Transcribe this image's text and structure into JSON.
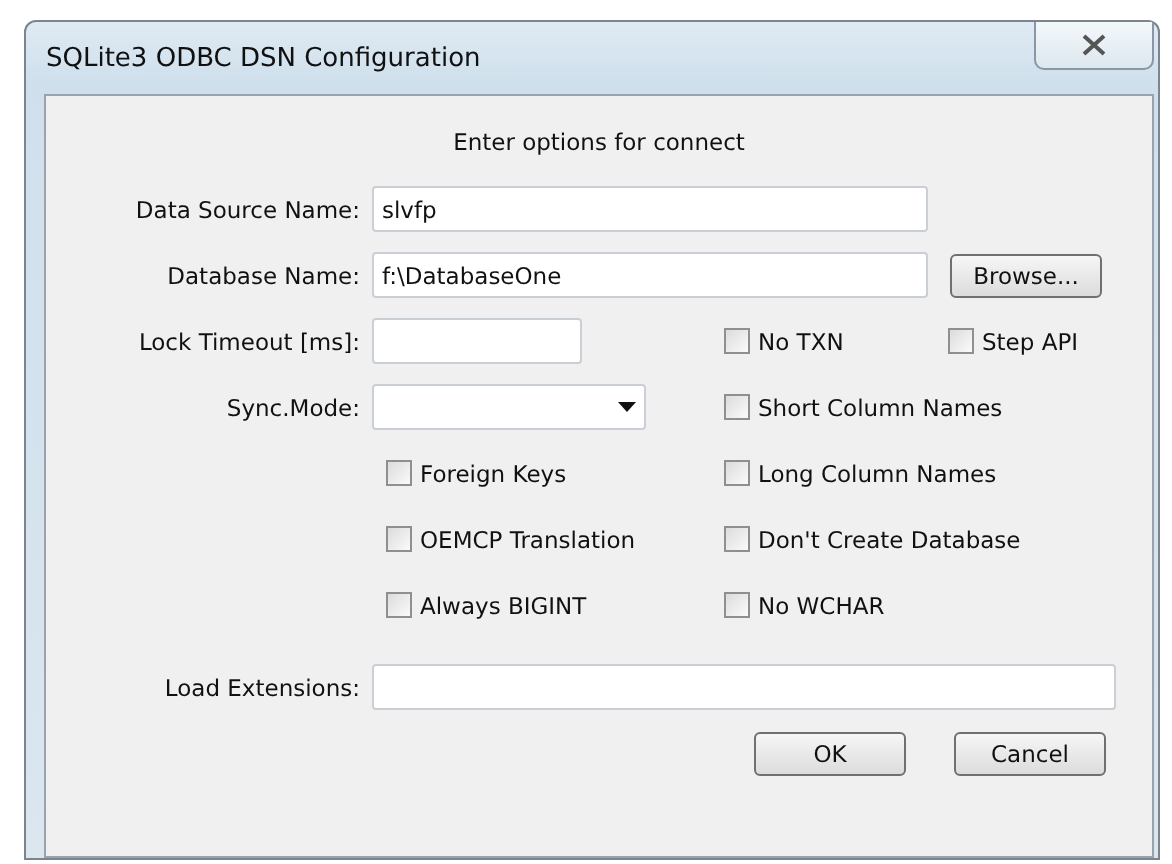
{
  "window": {
    "title": "SQLite3 ODBC DSN Configuration"
  },
  "heading": "Enter options for connect",
  "data_source_name": {
    "label": "Data Source Name:",
    "value": "slvfp"
  },
  "database_name": {
    "label": "Database Name:",
    "value": "f:\\DatabaseOne",
    "button": "Browse..."
  },
  "lock_timeout": {
    "label": "Lock Timeout [ms]:"
  },
  "sync_mode": {
    "label": "Sync.Mode:"
  },
  "options": [
    {
      "label": "No TXN",
      "checked": false
    },
    {
      "label": "Step API",
      "checked": false
    },
    {
      "label": "Short Column Names",
      "checked": false
    },
    {
      "label": "Foreign Keys",
      "checked": false
    },
    {
      "label": "Long Column Names",
      "checked": false
    },
    {
      "label": "OEMCP Translation",
      "checked": false
    },
    {
      "label": "Don't Create Database",
      "checked": false
    },
    {
      "label": "Always BIGINT",
      "checked": false
    },
    {
      "label": "No WCHAR",
      "checked": false
    }
  ],
  "load_extensions": {
    "label": "Load Extensions:"
  },
  "buttons": [
    "OK",
    "Cancel"
  ]
}
